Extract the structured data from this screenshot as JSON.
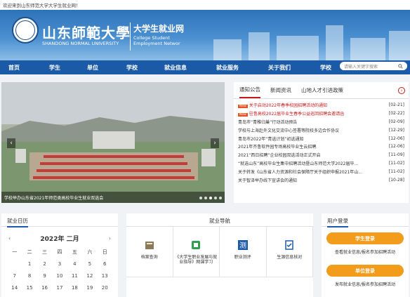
{
  "topbar": {
    "welcome": "欢迎来到山东师范大学大学生就业网！"
  },
  "banner": {
    "school_cn": "山东師範大學",
    "school_en": "SHANDONG NORMAL UNIVERSITY",
    "site_cn": "大学生就业网",
    "site_en_1": "College Student",
    "site_en_2": "Employment Networ"
  },
  "nav": {
    "items": [
      "首页",
      "学生",
      "单位",
      "学校",
      "就业信息",
      "就业服务",
      "关于我们",
      "学校"
    ],
    "search_placeholder": "请输入关键字搜索"
  },
  "slider": {
    "caption": "学校举办山东省2021年师范类高校毕业生就业双选会"
  },
  "news": {
    "tabs": [
      "通知公告",
      "新闻资讯",
      "山地人才引进政策"
    ],
    "items": [
      {
        "title": "关于启动2022年春季校园招聘活动的通知",
        "date": "[02-21]",
        "hot": true,
        "red": true
      },
      {
        "title": "驻鲁高校2022届毕业生春季公益巡回招聘会邀请函",
        "date": "[02-22]",
        "hot": true,
        "red": true
      },
      {
        "title": "青岛市“青稚归巢”行动活动预告",
        "date": "[02-09]",
        "hot": false,
        "red": false
      },
      {
        "title": "学校与上海赴外文化交流中心签署等院校多边合作协议",
        "date": "[12-29]",
        "hot": false,
        "red": false
      },
      {
        "title": "青岛市2022年“青选计划”初选通知",
        "date": "[12-06]",
        "hot": false,
        "red": false
      },
      {
        "title": "2021年齐鲁软件园专场高校毕业生云招聘",
        "date": "[12-06]",
        "hot": false,
        "red": false
      },
      {
        "title": "2021“西日招聘”企业校园双选活动正式开启",
        "date": "[11-09]",
        "hot": false,
        "red": false
      },
      {
        "title": "“就选山东”高校毕业生集中招聘活动暨山东师范大学2022届毕...",
        "date": "[11-02]",
        "hot": false,
        "red": false
      },
      {
        "title": "关于转发《山东省人力资源和社会保障厅关于组织申报2021年山...",
        "date": "[11-02]",
        "hot": false,
        "red": false
      },
      {
        "title": "关于智泽举办线下宣讲会的通知",
        "date": "[10-28]",
        "hot": false,
        "red": false
      }
    ]
  },
  "calendar": {
    "title": "就业日历",
    "month": "2022年 二月",
    "weekdays": [
      "一",
      "二",
      "三",
      "四",
      "五",
      "六",
      "日"
    ],
    "rows": [
      [
        "",
        "1",
        "2",
        "3",
        "4",
        "5",
        "6"
      ],
      [
        "7",
        "8",
        "9",
        "10",
        "11",
        "12",
        "13"
      ],
      [
        "14",
        "15",
        "16",
        "17",
        "18",
        "19",
        "20"
      ]
    ]
  },
  "guide": {
    "title": "就业导航",
    "items": [
      {
        "label": "档案查询",
        "icon": "archive-icon"
      },
      {
        "label": "《大学生职业发展与就业指导》网课学习",
        "icon": "book-icon"
      },
      {
        "label": "职业测评",
        "icon": "test-icon"
      },
      {
        "label": "生源信息核对",
        "icon": "check-doc-icon"
      }
    ]
  },
  "user": {
    "title": "用户登录",
    "student_btn": "学生登录",
    "student_desc": "查看就业信息/报名参加招聘活动",
    "company_btn": "单位登录",
    "company_desc": "发布就业信息/报名参加招聘活动"
  },
  "colors": {
    "nav": "#1a5aa6",
    "accent": "#c41b1b",
    "orange": "#f39b1b"
  }
}
